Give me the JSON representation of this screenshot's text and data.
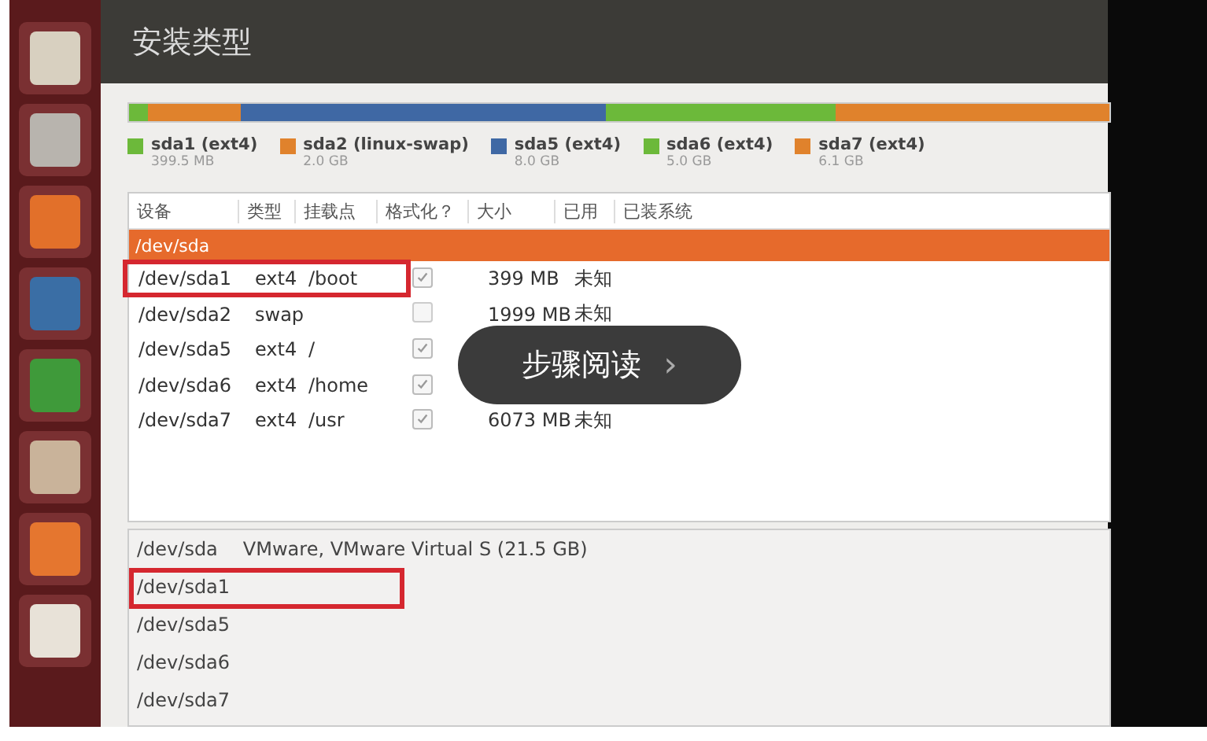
{
  "window": {
    "title": "安装类型"
  },
  "partitions": [
    {
      "name": "sda1 (ext4)",
      "size": "399.5 MB",
      "color": "#6cb93a"
    },
    {
      "name": "sda2 (linux-swap)",
      "size": "2.0 GB",
      "color": "#e0822c"
    },
    {
      "name": "sda5 (ext4)",
      "size": "8.0 GB",
      "color": "#3f68a4"
    },
    {
      "name": "sda6 (ext4)",
      "size": "5.0 GB",
      "color": "#6cb93a"
    },
    {
      "name": "sda7 (ext4)",
      "size": "6.1 GB",
      "color": "#e0822c"
    }
  ],
  "table": {
    "columns": [
      "设备",
      "类型",
      "挂载点",
      "格式化？",
      "大小",
      "已用",
      "已装系统"
    ],
    "disk": {
      "label": "/dev/sda",
      "selected": true
    },
    "rows": [
      {
        "device": "/dev/sda1",
        "type": "ext4",
        "mount": "/boot",
        "checked": true,
        "size": "399 MB",
        "used": "未知",
        "highlighted": true
      },
      {
        "device": "/dev/sda2",
        "type": "swap",
        "checked": false,
        "size": "1999 MB",
        "used": "未知",
        "highlighted": false
      },
      {
        "device": "/dev/sda5",
        "type": "ext4",
        "mount": "/",
        "checked": true,
        "highlighted": false
      },
      {
        "device": "/dev/sda6",
        "type": "ext4",
        "mount": "/home",
        "checked": true,
        "highlighted": false
      },
      {
        "device": "/dev/sda7",
        "type": "ext4",
        "mount": "/usr",
        "checked": true,
        "size": "6073 MB",
        "used": "未知",
        "highlighted": false
      }
    ]
  },
  "bootloader": [
    {
      "device": "/dev/sda",
      "description": "VMware, VMware Virtual S (21.5 GB)",
      "highlighted": false
    },
    {
      "device": "/dev/sda1",
      "highlighted": true
    },
    {
      "device": "/dev/sda5",
      "highlighted": false
    },
    {
      "device": "/dev/sda6",
      "highlighted": false
    },
    {
      "device": "/dev/sda7",
      "highlighted": false
    }
  ],
  "overlay": {
    "label": "步骤阅读",
    "arrow": "›"
  }
}
